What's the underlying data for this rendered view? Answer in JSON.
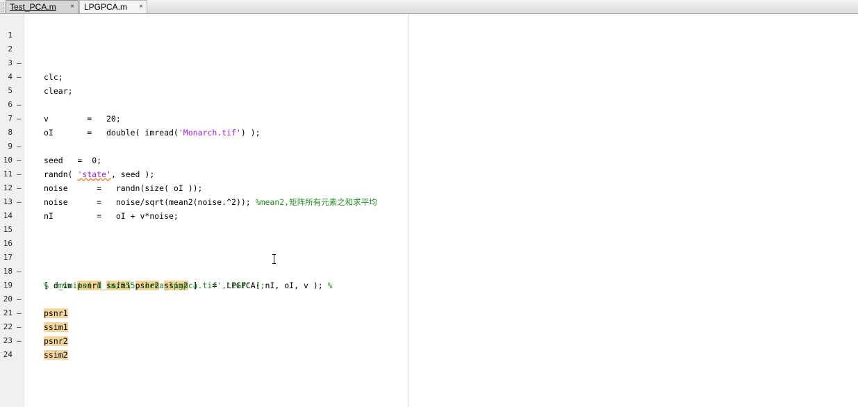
{
  "tabs": [
    {
      "label": "Test_PCA.m",
      "close": "×",
      "active": false
    },
    {
      "label": "LPGPCA.m",
      "close": "×",
      "active": true
    }
  ],
  "gutter": {
    "line_numbers": [
      "1",
      "2",
      "3",
      "4",
      "5",
      "6",
      "7",
      "8",
      "9",
      "10",
      "11",
      "12",
      "13",
      "14",
      "15",
      "16",
      "17",
      "18",
      "19",
      "20",
      "21",
      "22",
      "23",
      "24"
    ],
    "dash": "–"
  },
  "code": {
    "l2": "clc;",
    "l3": "clear;",
    "l5": "v        =   20;",
    "l6a": "oI       =   double( imread(",
    "l6s": "'Monarch.tif'",
    "l6b": ") );",
    "l8": "seed   =  0;",
    "l9a": "randn( ",
    "l9s": "'state'",
    "l9b": ", seed );",
    "l10": "noise      =   randn(size( oI ));",
    "l11a": "noise      =   noise/sqrt(mean2(noise.^2)); ",
    "l11c": "%mean2,矩阵所有元素之和求平均",
    "l17a": "[ d_im ",
    "l17h1": "psnr1",
    "l17h2": "ssim1",
    "l17h3": "psnr2",
    "l17h4": "ssim2",
    "l17b": " ]   =  LPGPCA( nI, oI, v ); ",
    "l17c": "%",
    "l18": "% imwrite( d_im/255,'lena_lpgpca.tif','tif' );",
    "l19": "psnr1",
    "l20": "ssim1",
    "l21": "psnr2",
    "l22": "ssim2",
    "l12": "nI         =   oI + v*noise;"
  },
  "colors": {
    "string": "#a020f0",
    "comment": "#228b22",
    "highlight": "#f3d49a"
  }
}
